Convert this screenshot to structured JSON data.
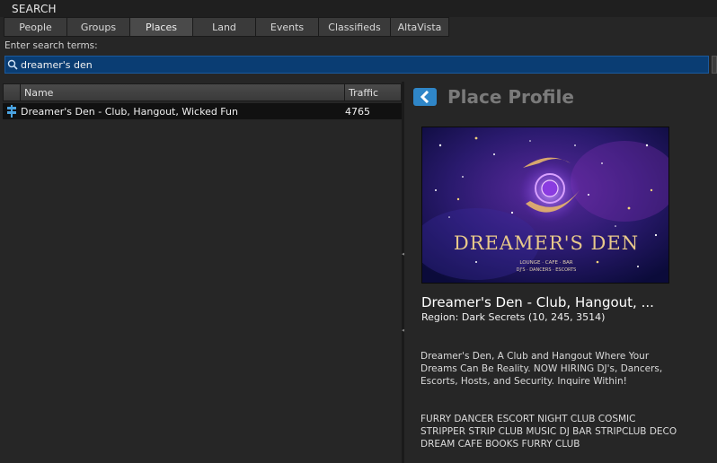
{
  "window": {
    "title": "SEARCH"
  },
  "tabs": [
    {
      "label": "People"
    },
    {
      "label": "Groups"
    },
    {
      "label": "Places"
    },
    {
      "label": "Land"
    },
    {
      "label": "Events"
    },
    {
      "label": "Classifieds"
    },
    {
      "label": "AltaVista"
    }
  ],
  "active_tab": "Places",
  "search": {
    "label": "Enter search terms:",
    "value": "dreamer's den"
  },
  "results": {
    "columns": {
      "name": "Name",
      "traffic": "Traffic"
    },
    "rows": [
      {
        "name": "Dreamer's Den - Club, Hangout, Wicked Fun",
        "traffic": "4765",
        "icon": "signpost-icon"
      }
    ]
  },
  "profile": {
    "title": "Place Profile",
    "back_icon": "chevron-left-icon",
    "image_text": {
      "logo": "DREAMER'S DEN",
      "line1": "LOUNGE · CAFE · BAR",
      "line2": "DJ'S · DANCERS · ESCORTS"
    },
    "place_name": "Dreamer's Den - Club, Hangout, ...",
    "region": "Region: Dark Secrets (10, 245, 3514)",
    "description": "Dreamer's Den, A Club and Hangout Where Your Dreams Can Be Reality. NOW HIRING DJ's, Dancers, Escorts, Hosts, and Security. Inquire Within!",
    "tags": "FURRY DANCER ESCORT NIGHT CLUB COSMIC STRIPPER STRIP CLUB MUSIC DJ BAR STRIPCLUB DECO DREAM CAFE BOOKS FURRY CLUB"
  },
  "colors": {
    "accent": "#2f86c8",
    "search_bg": "#0a3d73",
    "panel_bg": "#262626",
    "selected_row": "#111111"
  }
}
